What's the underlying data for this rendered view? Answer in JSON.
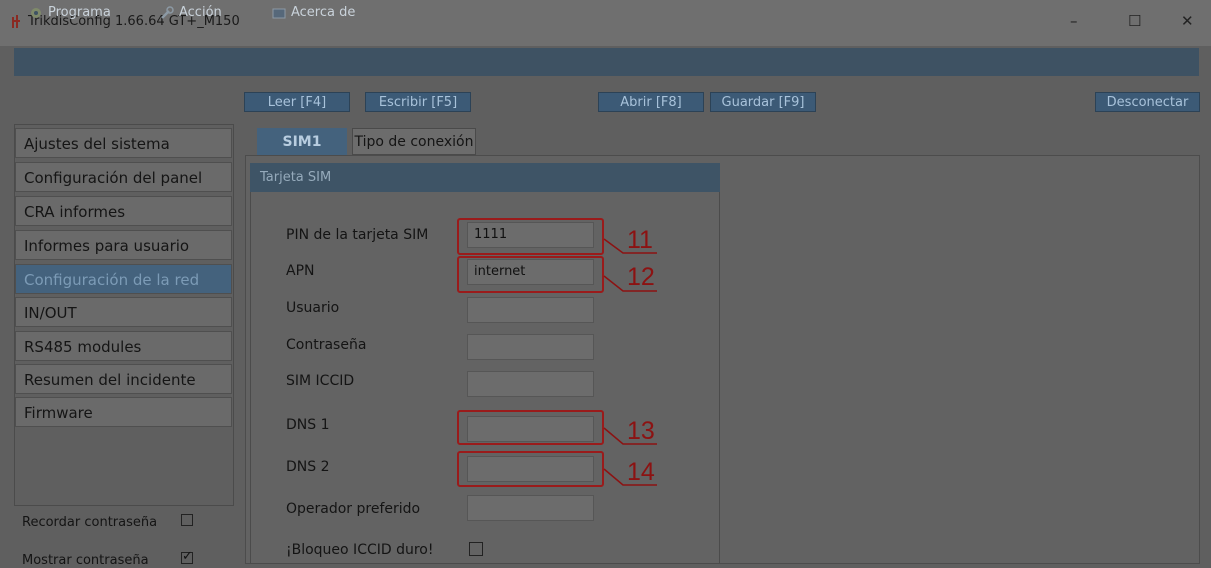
{
  "window": {
    "title": "TrikdisConfig 1.66.64   GT+_M150",
    "controls": {
      "minimize": "–",
      "maximize": "☐",
      "close": "✕"
    }
  },
  "menu": [
    {
      "label": "Programa",
      "icon": "gear-icon"
    },
    {
      "label": "Acción",
      "icon": "wrench-icon"
    },
    {
      "label": "Acerca de",
      "icon": "info-icon"
    }
  ],
  "toolbar": {
    "read": "Leer [F4]",
    "write": "Escribir [F5]",
    "open": "Abrir [F8]",
    "save": "Guardar [F9]",
    "disconnect": "Desconectar"
  },
  "nav": {
    "items": [
      "Ajustes del sistema",
      "Configuración del panel",
      "CRA informes",
      "Informes para usuario",
      "Configuración de la red",
      "IN/OUT",
      "RS485 modules",
      "Resumen del incidente",
      "Firmware"
    ],
    "active_index": 4,
    "remember_password": {
      "label": "Recordar contraseña",
      "checked": false
    },
    "show_password": {
      "label": "Mostrar contraseña",
      "checked": true
    }
  },
  "tabs": [
    "SIM1",
    "Tipo de conexión"
  ],
  "sim": {
    "group_title": "Tarjeta SIM",
    "fields": [
      {
        "label": "PIN de la tarjeta SIM",
        "value": "1111"
      },
      {
        "label": "APN",
        "value": "internet"
      },
      {
        "label": "Usuario",
        "value": ""
      },
      {
        "label": "Contraseña",
        "value": ""
      },
      {
        "label": "SIM ICCID",
        "value": ""
      },
      {
        "label": "DNS 1",
        "value": ""
      },
      {
        "label": "DNS 2",
        "value": ""
      },
      {
        "label": "Operador preferido",
        "value": ""
      }
    ],
    "hard_iccid_lock": {
      "label": "¡Bloqueo ICCID duro!",
      "checked": false
    }
  },
  "callouts": [
    "11",
    "12",
    "13",
    "14"
  ],
  "colors": {
    "highlight_red": "#9a1b1b",
    "accent_blue": "#44627d"
  }
}
